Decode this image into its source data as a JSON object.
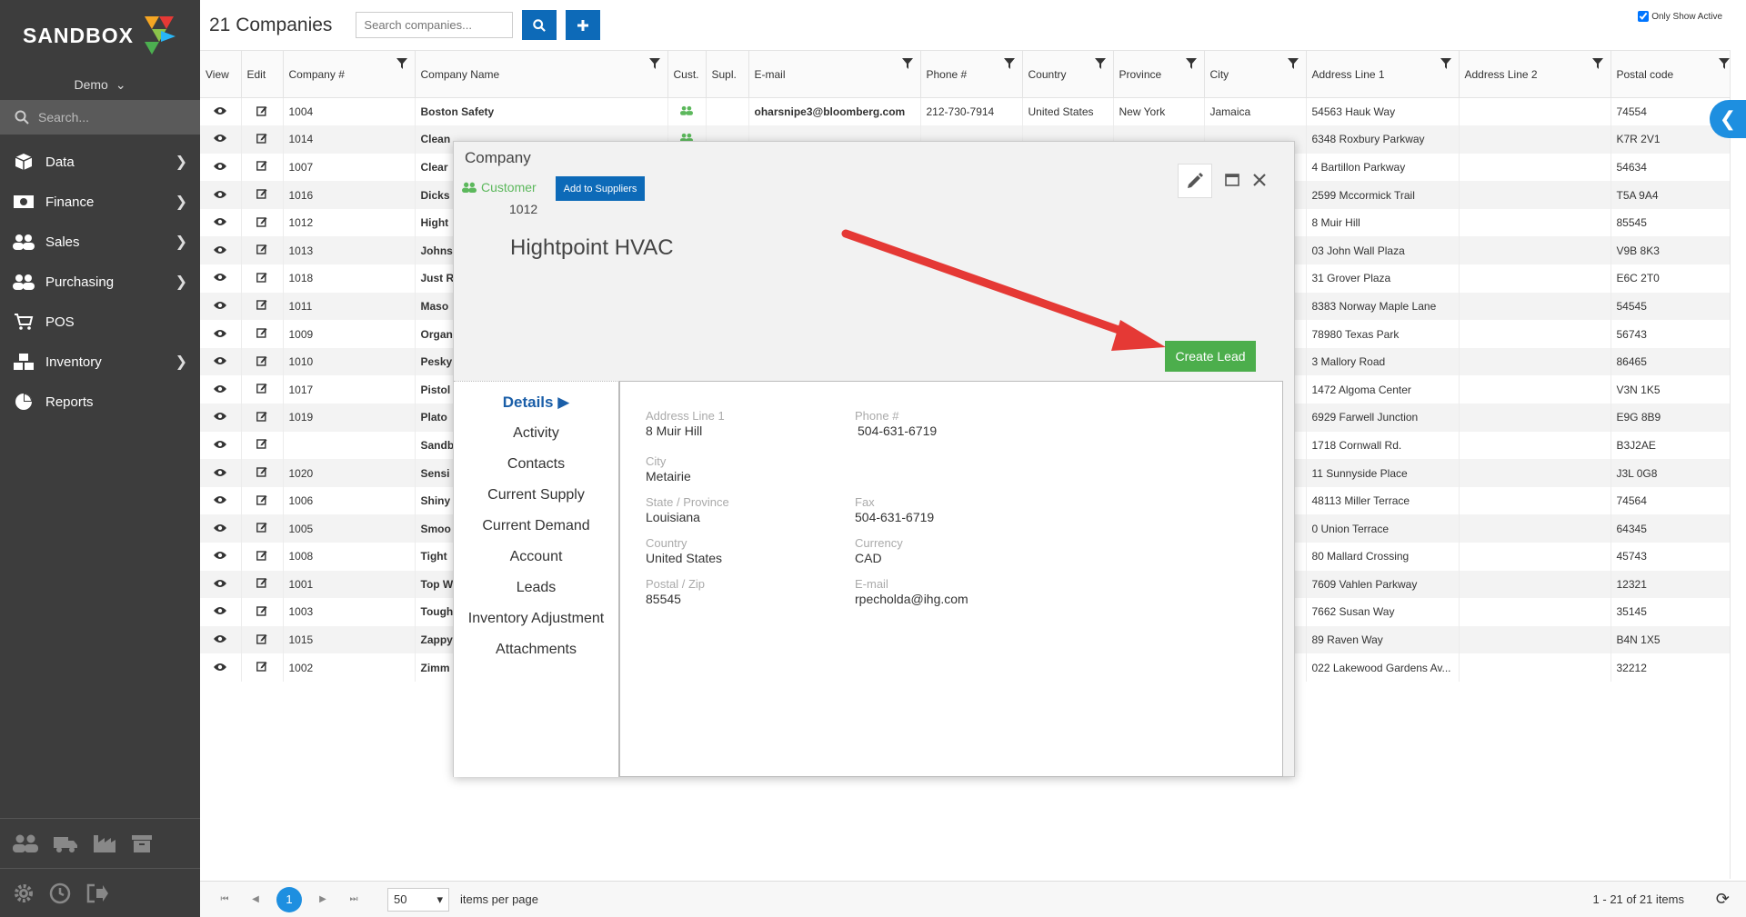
{
  "app": {
    "logo": "SANDBOX",
    "user": "Demo",
    "search_placeholder": "Search..."
  },
  "nav": [
    {
      "label": "Data",
      "icon": "cube-icon",
      "has_sub": true
    },
    {
      "label": "Finance",
      "icon": "money-icon",
      "has_sub": true
    },
    {
      "label": "Sales",
      "icon": "users-icon",
      "has_sub": true
    },
    {
      "label": "Purchasing",
      "icon": "users-icon",
      "has_sub": true
    },
    {
      "label": "POS",
      "icon": "cart-icon",
      "has_sub": false
    },
    {
      "label": "Inventory",
      "icon": "cubes-icon",
      "has_sub": true
    },
    {
      "label": "Reports",
      "icon": "pie-chart-icon",
      "has_sub": false
    }
  ],
  "page": {
    "title": "21 Companies",
    "search_placeholder": "Search companies...",
    "only_active_label": "Only Show Active",
    "only_active_checked": true
  },
  "table": {
    "columns": [
      "View",
      "Edit",
      "Company #",
      "Company Name",
      "Cust.",
      "Supl.",
      "E-mail",
      "Phone #",
      "Country",
      "Province",
      "City",
      "Address Line 1",
      "Address Line 2",
      "Postal code"
    ],
    "rows": [
      {
        "num": "1004",
        "name": "Boston Safety",
        "cust": true,
        "email": "oharsnipe3@bloomberg.com",
        "phone": "212-730-7914",
        "country": "United States",
        "province": "New York",
        "city": "Jamaica",
        "addr1": "54563 Hauk Way",
        "addr2": "",
        "postal": "74554"
      },
      {
        "num": "1014",
        "name": "Clean",
        "cust": true,
        "email": "",
        "phone": "",
        "country": "",
        "province": "",
        "city": "",
        "addr1": "6348 Roxbury Parkway",
        "addr2": "",
        "postal": "K7R 2V1"
      },
      {
        "num": "1007",
        "name": "Clear",
        "cust": false,
        "email": "",
        "phone": "",
        "country": "",
        "province": "",
        "city": "",
        "addr1": "4 Bartillon Parkway",
        "addr2": "",
        "postal": "54634"
      },
      {
        "num": "1016",
        "name": "Dicks",
        "cust": false,
        "email": "",
        "phone": "",
        "country": "",
        "province": "",
        "city": "",
        "addr1": "2599 Mccormick Trail",
        "addr2": "",
        "postal": "T5A 9A4"
      },
      {
        "num": "1012",
        "name": "Hight",
        "cust": false,
        "email": "",
        "phone": "",
        "country": "",
        "province": "",
        "city": "",
        "addr1": "8 Muir Hill",
        "addr2": "",
        "postal": "85545"
      },
      {
        "num": "1013",
        "name": "Johns",
        "cust": false,
        "email": "",
        "phone": "",
        "country": "",
        "province": "",
        "city": "",
        "addr1": "03 John Wall Plaza",
        "addr2": "",
        "postal": "V9B 8K3"
      },
      {
        "num": "1018",
        "name": "Just R",
        "cust": false,
        "email": "",
        "phone": "",
        "country": "",
        "province": "",
        "city": "",
        "addr1": "31 Grover Plaza",
        "addr2": "",
        "postal": "E6C 2T0"
      },
      {
        "num": "1011",
        "name": "Maso",
        "cust": false,
        "email": "",
        "phone": "",
        "country": "",
        "province": "",
        "city": "",
        "addr1": "8383 Norway Maple Lane",
        "addr2": "",
        "postal": "54545"
      },
      {
        "num": "1009",
        "name": "Organ",
        "cust": false,
        "email": "",
        "phone": "",
        "country": "",
        "province": "",
        "city": "",
        "addr1": "78980 Texas Park",
        "addr2": "",
        "postal": "56743"
      },
      {
        "num": "1010",
        "name": "Pesky",
        "cust": false,
        "email": "",
        "phone": "",
        "country": "",
        "province": "",
        "city": "",
        "addr1": "3 Mallory Road",
        "addr2": "",
        "postal": "86465"
      },
      {
        "num": "1017",
        "name": "Pistol",
        "cust": false,
        "email": "",
        "phone": "",
        "country": "",
        "province": "",
        "city": "",
        "addr1": "1472 Algoma Center",
        "addr2": "",
        "postal": "V3N 1K5"
      },
      {
        "num": "1019",
        "name": "Plato",
        "cust": false,
        "email": "",
        "phone": "",
        "country": "",
        "province": "",
        "city": "",
        "addr1": "6929 Farwell Junction",
        "addr2": "",
        "postal": "E9G 8B9"
      },
      {
        "num": "",
        "name": "Sandb",
        "cust": false,
        "email": "",
        "phone": "",
        "country": "",
        "province": "",
        "city": "",
        "addr1": "1718 Cornwall Rd.",
        "addr2": "",
        "postal": "B3J2AE"
      },
      {
        "num": "1020",
        "name": "Sensi",
        "cust": false,
        "email": "",
        "phone": "",
        "country": "",
        "province": "",
        "city": "",
        "addr1": "11 Sunnyside Place",
        "addr2": "",
        "postal": "J3L 0G8"
      },
      {
        "num": "1006",
        "name": "Shiny",
        "cust": false,
        "email": "",
        "phone": "",
        "country": "",
        "province": "",
        "city": "",
        "addr1": "48113 Miller Terrace",
        "addr2": "",
        "postal": "74564"
      },
      {
        "num": "1005",
        "name": "Smoo",
        "cust": false,
        "email": "",
        "phone": "",
        "country": "",
        "province": "",
        "city": "",
        "addr1": "0 Union Terrace",
        "addr2": "",
        "postal": "64345"
      },
      {
        "num": "1008",
        "name": "Tight",
        "cust": false,
        "email": "",
        "phone": "",
        "country": "",
        "province": "",
        "city": "",
        "addr1": "80 Mallard Crossing",
        "addr2": "",
        "postal": "45743"
      },
      {
        "num": "1001",
        "name": "Top W",
        "cust": false,
        "email": "",
        "phone": "",
        "country": "",
        "province": "",
        "city": "",
        "addr1": "7609 Vahlen Parkway",
        "addr2": "",
        "postal": "12321"
      },
      {
        "num": "1003",
        "name": "Tough",
        "cust": false,
        "email": "",
        "phone": "",
        "country": "",
        "province": "",
        "city": "",
        "addr1": "7662 Susan Way",
        "addr2": "",
        "postal": "35145"
      },
      {
        "num": "1015",
        "name": "Zappy",
        "cust": false,
        "email": "",
        "phone": "",
        "country": "",
        "province": "",
        "city": "",
        "addr1": "89 Raven Way",
        "addr2": "",
        "postal": "B4N 1X5"
      },
      {
        "num": "1002",
        "name": "Zimm",
        "cust": false,
        "email": "",
        "phone": "",
        "country": "",
        "province": "",
        "city": "",
        "addr1": "022 Lakewood Gardens Av...",
        "addr2": "",
        "postal": "32212"
      }
    ]
  },
  "pager": {
    "current_page": "1",
    "per_page": "50",
    "per_page_label": "items per page",
    "info": "1 - 21 of 21 items"
  },
  "modal": {
    "title": "Company",
    "badge": "Customer",
    "add_suppliers_label": "Add to Suppliers",
    "company_number": "1012",
    "company_name": "Hightpoint HVAC",
    "create_lead_label": "Create Lead",
    "tabs": [
      "Details",
      "Activity",
      "Contacts",
      "Current Supply",
      "Current Demand",
      "Account",
      "Leads",
      "Inventory Adjustment",
      "Attachments"
    ],
    "details": {
      "address_line1_label": "Address Line 1",
      "address_line1": "8 Muir Hill",
      "city_label": "City",
      "city": "Metairie",
      "state_label": "State / Province",
      "state": "Louisiana",
      "country_label": "Country",
      "country": "United States",
      "postal_label": "Postal / Zip",
      "postal": "85545",
      "phone_label": "Phone #",
      "phone": "504-631-6719",
      "fax_label": "Fax",
      "fax": "504-631-6719",
      "currency_label": "Currency",
      "currency": "CAD",
      "email_label": "E-mail",
      "email": "rpecholda@ihg.com"
    }
  },
  "colors": {
    "sidebar": "#3d3d3d",
    "accent_blue": "#0d6ab8",
    "link_blue": "#1a5ea8",
    "green": "#4cae4c",
    "arrow_red": "#e53935"
  }
}
